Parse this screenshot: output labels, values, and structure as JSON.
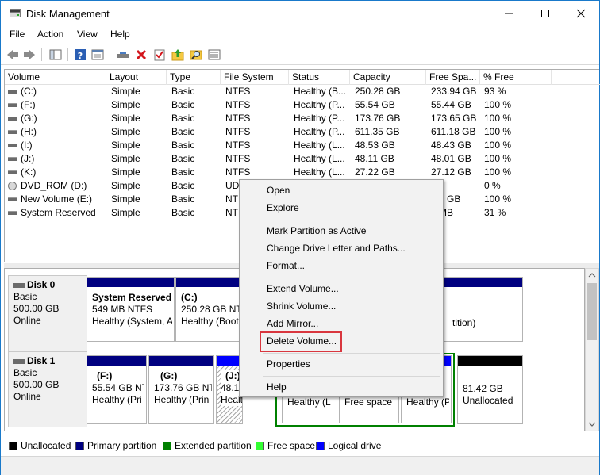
{
  "window": {
    "title": "Disk Management",
    "controls": [
      "minimize-icon",
      "maximize-icon",
      "close-icon"
    ]
  },
  "menu": [
    "File",
    "Action",
    "View",
    "Help"
  ],
  "toolbar_icons": [
    "back-icon",
    "forward-icon",
    "console-tree-icon",
    "help-icon",
    "properties-icon",
    "connect-icon",
    "delete-icon",
    "checkbox-icon",
    "up-folder-icon",
    "search-icon",
    "list-icon"
  ],
  "columns": [
    "Volume",
    "Layout",
    "Type",
    "File System",
    "Status",
    "Capacity",
    "Free Spa...",
    "% Free"
  ],
  "volumes": [
    {
      "name": "(C:)",
      "layout": "Simple",
      "type": "Basic",
      "fs": "NTFS",
      "status": "Healthy (B...",
      "capacity": "250.28 GB",
      "free": "233.94 GB",
      "pct": "93 %"
    },
    {
      "name": "(F:)",
      "layout": "Simple",
      "type": "Basic",
      "fs": "NTFS",
      "status": "Healthy (P...",
      "capacity": "55.54 GB",
      "free": "55.44 GB",
      "pct": "100 %"
    },
    {
      "name": "(G:)",
      "layout": "Simple",
      "type": "Basic",
      "fs": "NTFS",
      "status": "Healthy (P...",
      "capacity": "173.76 GB",
      "free": "173.65 GB",
      "pct": "100 %"
    },
    {
      "name": "(H:)",
      "layout": "Simple",
      "type": "Basic",
      "fs": "NTFS",
      "status": "Healthy (P...",
      "capacity": "611.35 GB",
      "free": "611.18 GB",
      "pct": "100 %"
    },
    {
      "name": "(I:)",
      "layout": "Simple",
      "type": "Basic",
      "fs": "NTFS",
      "status": "Healthy (L...",
      "capacity": "48.53 GB",
      "free": "48.43 GB",
      "pct": "100 %"
    },
    {
      "name": "(J:)",
      "layout": "Simple",
      "type": "Basic",
      "fs": "NTFS",
      "status": "Healthy (L...",
      "capacity": "48.11 GB",
      "free": "48.01 GB",
      "pct": "100 %"
    },
    {
      "name": "(K:)",
      "layout": "Simple",
      "type": "Basic",
      "fs": "NTFS",
      "status": "Healthy (L...",
      "capacity": "27.22 GB",
      "free": "27.12 GB",
      "pct": "100 %"
    },
    {
      "name": "DVD_ROM (D:)",
      "layout": "Simple",
      "type": "Basic",
      "fs": "UD",
      "status": "",
      "capacity": "",
      "free": "",
      "pct": "0 %"
    },
    {
      "name": "New Volume (E:)",
      "layout": "Simple",
      "type": "Basic",
      "fs": "NT",
      "status": "",
      "capacity": "",
      "free": ".81 GB",
      "pct": "100 %"
    },
    {
      "name": "System Reserved",
      "layout": "Simple",
      "type": "Basic",
      "fs": "NT",
      "status": "",
      "capacity": "",
      "free": "0 MB",
      "pct": "31 %"
    }
  ],
  "disks": [
    {
      "name": "Disk 0",
      "type": "Basic",
      "size": "500.00 GB",
      "state": "Online",
      "partitions": [
        {
          "title": "System Reserved",
          "size": "549 MB NTFS",
          "status": "Healthy (System, A"
        },
        {
          "title": "(C:)",
          "size": "250.28 GB NTF",
          "status": "Healthy (Boot"
        },
        {
          "title": "",
          "size": "",
          "status": "tition)"
        }
      ]
    },
    {
      "name": "Disk 1",
      "type": "Basic",
      "size": "500.00 GB",
      "state": "Online",
      "partitions": [
        {
          "title": "(F:)",
          "size": "55.54 GB NT",
          "status": "Healthy (Pri"
        },
        {
          "title": "(G:)",
          "size": "173.76 GB NT",
          "status": "Healthy (Prin"
        },
        {
          "title": "(J:)",
          "size": "48.1",
          "status": "Healthy (P"
        },
        {
          "title": "",
          "size": "",
          "status": "Healthy (L"
        },
        {
          "title": "",
          "size": "",
          "status": "Free space"
        },
        {
          "title": "",
          "size": "",
          "status": "Healthy (P"
        },
        {
          "title": "",
          "size": "81.42 GB",
          "status": "Unallocated"
        }
      ]
    }
  ],
  "legend": [
    {
      "label": "Unallocated",
      "color": "#000000"
    },
    {
      "label": "Primary partition",
      "color": "#000080"
    },
    {
      "label": "Extended partition",
      "color": "#008000"
    },
    {
      "label": "Free space",
      "color": "#33ff33"
    },
    {
      "label": "Logical drive",
      "color": "#0000ff"
    }
  ],
  "context_menu": {
    "groups": [
      [
        "Open",
        "Explore"
      ],
      [
        "Mark Partition as Active",
        "Change Drive Letter and Paths...",
        "Format..."
      ],
      [
        "Extend Volume...",
        "Shrink Volume...",
        "Add Mirror...",
        "Delete Volume..."
      ],
      [
        "Properties"
      ],
      [
        "Help"
      ]
    ],
    "highlighted": "Delete Volume...",
    "highlight_color": "#d9363e"
  }
}
